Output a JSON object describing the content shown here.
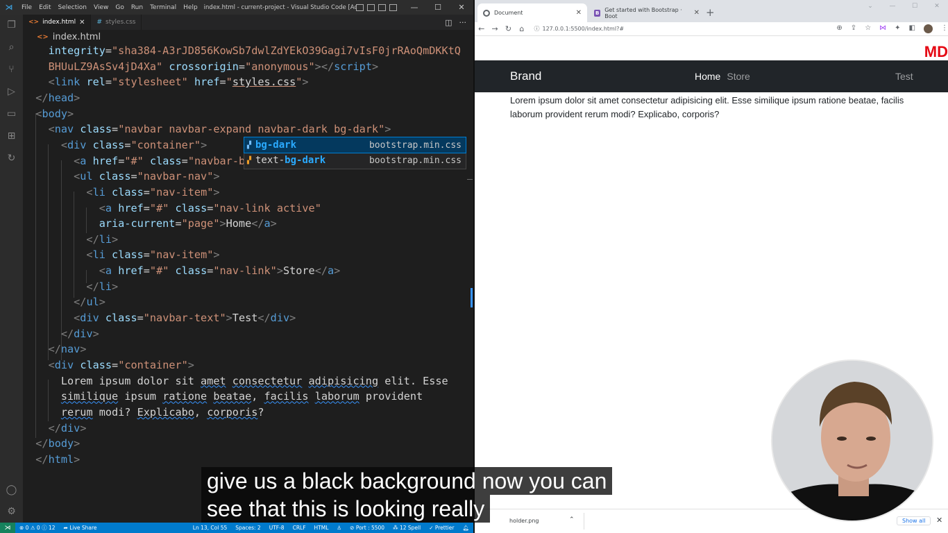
{
  "vscode": {
    "menu": [
      "File",
      "Edit",
      "Selection",
      "View",
      "Go",
      "Run",
      "Terminal",
      "Help"
    ],
    "window_title": "index.html - current-project - Visual Studio Code [Administrator] [Unsu...",
    "tabs": [
      {
        "label": "index.html",
        "active": true
      },
      {
        "label": "styles.css",
        "active": false
      }
    ],
    "breadcrumb": "index.html",
    "code_lines": [
      [
        [
          "a",
          "    integrity"
        ],
        [
          "w",
          "="
        ],
        [
          "s",
          "\"sha384-A3rJD856KowSb7dwlZdYEkO39Gagi7vIsF0jrRAoQmDKKtQ"
        ]
      ],
      [
        [
          "s",
          "    BHUuLZ9AsSv4jD4Xa\""
        ],
        [
          "w",
          " "
        ],
        [
          "a",
          "crossorigin"
        ],
        [
          "w",
          "="
        ],
        [
          "s",
          "\"anonymous\""
        ],
        [
          "br",
          "></"
        ],
        [
          "t",
          "script"
        ],
        [
          "br",
          ">"
        ]
      ],
      [
        [
          "br",
          "    <"
        ],
        [
          "t",
          "link"
        ],
        [
          "w",
          " "
        ],
        [
          "a",
          "rel"
        ],
        [
          "w",
          "="
        ],
        [
          "s",
          "\"stylesheet\""
        ],
        [
          "w",
          " "
        ],
        [
          "a",
          "href"
        ],
        [
          "w",
          "="
        ],
        [
          "s",
          "\""
        ],
        [
          "lk",
          "styles.css"
        ],
        [
          "s",
          "\""
        ],
        [
          "br",
          ">"
        ]
      ],
      [
        [
          "br",
          "  </"
        ],
        [
          "t",
          "head"
        ],
        [
          "br",
          ">"
        ]
      ],
      [
        [
          "br",
          "  <"
        ],
        [
          "t",
          "body"
        ],
        [
          "br",
          ">"
        ]
      ],
      [
        [
          "br",
          "    <"
        ],
        [
          "t",
          "nav"
        ],
        [
          "w",
          " "
        ],
        [
          "a",
          "class"
        ],
        [
          "w",
          "="
        ],
        [
          "s",
          "\"navbar navbar-expand navbar-dark bg-dark\""
        ],
        [
          "br",
          ">"
        ]
      ],
      [
        [
          "br",
          "      <"
        ],
        [
          "t",
          "div"
        ],
        [
          "w",
          " "
        ],
        [
          "a",
          "class"
        ],
        [
          "w",
          "="
        ],
        [
          "s",
          "\"container\""
        ],
        [
          "br",
          ">"
        ]
      ],
      [
        [
          "br",
          "        <"
        ],
        [
          "t",
          "a"
        ],
        [
          "w",
          " "
        ],
        [
          "a",
          "href"
        ],
        [
          "w",
          "="
        ],
        [
          "s",
          "\"#\""
        ],
        [
          "w",
          " "
        ],
        [
          "a",
          "class"
        ],
        [
          "w",
          "="
        ],
        [
          "s",
          "\"navbar-b"
        ]
      ],
      [
        [
          "br",
          "        <"
        ],
        [
          "t",
          "ul"
        ],
        [
          "w",
          " "
        ],
        [
          "a",
          "class"
        ],
        [
          "w",
          "="
        ],
        [
          "s",
          "\"navbar-nav\""
        ],
        [
          "br",
          ">"
        ]
      ],
      [
        [
          "br",
          "          <"
        ],
        [
          "t",
          "li"
        ],
        [
          "w",
          " "
        ],
        [
          "a",
          "class"
        ],
        [
          "w",
          "="
        ],
        [
          "s",
          "\"nav-item\""
        ],
        [
          "br",
          ">"
        ]
      ],
      [
        [
          "br",
          "            <"
        ],
        [
          "t",
          "a"
        ],
        [
          "w",
          " "
        ],
        [
          "a",
          "href"
        ],
        [
          "w",
          "="
        ],
        [
          "s",
          "\"#\""
        ],
        [
          "w",
          " "
        ],
        [
          "a",
          "class"
        ],
        [
          "w",
          "="
        ],
        [
          "s",
          "\"nav-link active\""
        ]
      ],
      [
        [
          "a",
          "            aria-current"
        ],
        [
          "w",
          "="
        ],
        [
          "s",
          "\"page\""
        ],
        [
          "br",
          ">"
        ],
        [
          "w",
          "Home"
        ],
        [
          "br",
          "</"
        ],
        [
          "t",
          "a"
        ],
        [
          "br",
          ">"
        ]
      ],
      [
        [
          "br",
          "          </"
        ],
        [
          "t",
          "li"
        ],
        [
          "br",
          ">"
        ]
      ],
      [
        [
          "br",
          "          <"
        ],
        [
          "t",
          "li"
        ],
        [
          "w",
          " "
        ],
        [
          "a",
          "class"
        ],
        [
          "w",
          "="
        ],
        [
          "s",
          "\"nav-item\""
        ],
        [
          "br",
          ">"
        ]
      ],
      [
        [
          "br",
          "            <"
        ],
        [
          "t",
          "a"
        ],
        [
          "w",
          " "
        ],
        [
          "a",
          "href"
        ],
        [
          "w",
          "="
        ],
        [
          "s",
          "\"#\""
        ],
        [
          "w",
          " "
        ],
        [
          "a",
          "class"
        ],
        [
          "w",
          "="
        ],
        [
          "s",
          "\"nav-link\""
        ],
        [
          "br",
          ">"
        ],
        [
          "w",
          "Store"
        ],
        [
          "br",
          "</"
        ],
        [
          "t",
          "a"
        ],
        [
          "br",
          ">"
        ]
      ],
      [
        [
          "br",
          "          </"
        ],
        [
          "t",
          "li"
        ],
        [
          "br",
          ">"
        ]
      ],
      [
        [
          "br",
          "        </"
        ],
        [
          "t",
          "ul"
        ],
        [
          "br",
          ">"
        ]
      ],
      [
        [
          "br",
          "        <"
        ],
        [
          "t",
          "div"
        ],
        [
          "w",
          " "
        ],
        [
          "a",
          "class"
        ],
        [
          "w",
          "="
        ],
        [
          "s",
          "\"navbar-text\""
        ],
        [
          "br",
          ">"
        ],
        [
          "w",
          "Test"
        ],
        [
          "br",
          "</"
        ],
        [
          "t",
          "div"
        ],
        [
          "br",
          ">"
        ]
      ],
      [
        [
          "br",
          "      </"
        ],
        [
          "t",
          "div"
        ],
        [
          "br",
          ">"
        ]
      ],
      [
        [
          "br",
          "    </"
        ],
        [
          "t",
          "nav"
        ],
        [
          "br",
          ">"
        ]
      ],
      [
        [
          "br",
          "    <"
        ],
        [
          "t",
          "div"
        ],
        [
          "w",
          " "
        ],
        [
          "a",
          "class"
        ],
        [
          "w",
          "="
        ],
        [
          "s",
          "\"container\""
        ],
        [
          "br",
          ">"
        ]
      ],
      [
        [
          "w",
          "      Lorem ipsum dolor sit "
        ],
        [
          "sq",
          "amet"
        ],
        [
          "w",
          " "
        ],
        [
          "sq",
          "consectetur"
        ],
        [
          "w",
          " "
        ],
        [
          "sq",
          "adipisicing"
        ],
        [
          "w",
          " elit. Esse"
        ]
      ],
      [
        [
          "w",
          "      "
        ],
        [
          "sq",
          "similique"
        ],
        [
          "w",
          " ipsum "
        ],
        [
          "sq",
          "ratione"
        ],
        [
          "w",
          " "
        ],
        [
          "sq",
          "beatae"
        ],
        [
          "w",
          ", "
        ],
        [
          "sq",
          "facilis"
        ],
        [
          "w",
          " "
        ],
        [
          "sq",
          "laborum"
        ],
        [
          "w",
          " provident"
        ]
      ],
      [
        [
          "w",
          "      "
        ],
        [
          "sq",
          "rerum"
        ],
        [
          "w",
          " modi? "
        ],
        [
          "sq",
          "Explicabo"
        ],
        [
          "w",
          ", "
        ],
        [
          "sq",
          "corporis"
        ],
        [
          "w",
          "?"
        ]
      ],
      [
        [
          "br",
          "    </"
        ],
        [
          "t",
          "div"
        ],
        [
          "br",
          ">"
        ]
      ],
      [
        [
          "br",
          "  </"
        ],
        [
          "t",
          "body"
        ],
        [
          "br",
          ">"
        ]
      ],
      [
        [
          "br",
          "  </"
        ],
        [
          "t",
          "html"
        ],
        [
          "br",
          ">"
        ]
      ]
    ],
    "suggest": [
      {
        "prefix": "",
        "match": "bg-dark",
        "detail": "bootstrap.min.css",
        "selected": true
      },
      {
        "prefix": "text-",
        "match": "bg-dark",
        "detail": "bootstrap.min.css",
        "selected": false
      }
    ],
    "status": {
      "errors": "⊗ 0 ⚠ 0 ⓘ 12",
      "live_share": "Live Share",
      "position": "Ln 13, Col 55",
      "spaces": "Spaces: 2",
      "encoding": "UTF-8",
      "eol": "CRLF",
      "language": "HTML",
      "port": "Port : 5500",
      "spell": "12 Spell",
      "prettier": "✓ Prettier"
    }
  },
  "browser": {
    "tabs": [
      {
        "label": "Document",
        "active": true
      },
      {
        "label": "Get started with Bootstrap · Boot",
        "active": false
      }
    ],
    "url": "127.0.0.1:5500/index.html?#",
    "page": {
      "logo": "MD",
      "brand": "Brand",
      "nav_home": "Home",
      "nav_store": "Store",
      "nav_text": "Test",
      "body_text": "Lorem ipsum dolor sit amet consectetur adipisicing elit. Esse similique ipsum ratione beatae, facilis laborum provident rerum modi? Explicabo, corporis?"
    },
    "downloads": {
      "file": "holder.png",
      "show_all": "Show all"
    }
  },
  "caption": {
    "line1": "give us a black background now you can",
    "line2": "see that this is looking really"
  }
}
